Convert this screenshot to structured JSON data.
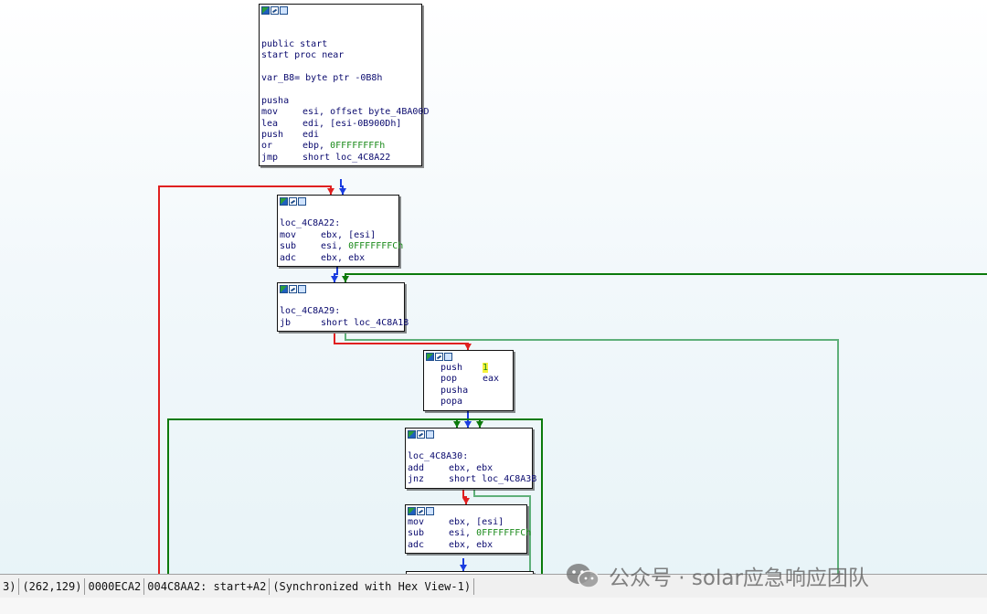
{
  "colors": {
    "flow_true": "#0b7a0b",
    "flow_false": "#e02020",
    "flow_uncond": "#1a3de0",
    "flow_loop": "#5fb07a",
    "instruction": "#0a0a6e",
    "immediate": "#1a8a1a",
    "highlight": "#f6f23c"
  },
  "nodes": [
    {
      "id": "start",
      "lines": [
        [
          ""
        ],
        [
          ""
        ],
        [
          "public start"
        ],
        [
          "start proc near"
        ],
        [
          ""
        ],
        [
          "var_B8= byte ptr -0B8h"
        ],
        [
          ""
        ],
        [
          "pusha"
        ],
        [
          "mov",
          "esi, offset byte_4BA00D"
        ],
        [
          "lea",
          "edi, [esi-0B900Dh]"
        ],
        [
          "push",
          "edi"
        ],
        [
          "or",
          "ebp, ",
          "0FFFFFFFFh"
        ],
        [
          "jmp",
          "short loc_4C8A22"
        ]
      ]
    },
    {
      "id": "loc_4C8A22",
      "lines": [
        [
          ""
        ],
        [
          "loc_4C8A22:"
        ],
        [
          "mov",
          "ebx, [esi]"
        ],
        [
          "sub",
          "esi, ",
          "0FFFFFFFCh"
        ],
        [
          "adc",
          "ebx, ebx"
        ]
      ]
    },
    {
      "id": "loc_4C8A29",
      "lines": [
        [
          ""
        ],
        [
          "loc_4C8A29:"
        ],
        [
          "jb",
          "short loc_4C8A18"
        ]
      ]
    },
    {
      "id": "push1",
      "lines": [
        [
          "push",
          "",
          "1"
        ],
        [
          "pop",
          "eax"
        ],
        [
          "pusha"
        ],
        [
          "popa"
        ]
      ]
    },
    {
      "id": "loc_4C8A30",
      "lines": [
        [
          ""
        ],
        [
          "loc_4C8A30:"
        ],
        [
          "add",
          "ebx, ebx"
        ],
        [
          "jnz",
          "short loc_4C8A3B"
        ]
      ]
    },
    {
      "id": "block6",
      "lines": [
        [
          "mov",
          "ebx, [esi]"
        ],
        [
          "sub",
          "esi, ",
          "0FFFFFFFCh"
        ],
        [
          "adc",
          "ebx, ebx"
        ]
      ]
    }
  ],
  "status_bar": {
    "cells": [
      "3)",
      "(262,129)",
      "0000ECA2",
      "004C8AA2: start+A2",
      "(Synchronized with Hex View-1)"
    ]
  },
  "watermark": {
    "icon": "wechat-icon",
    "text": "公众号 · solar应急响应团队"
  }
}
